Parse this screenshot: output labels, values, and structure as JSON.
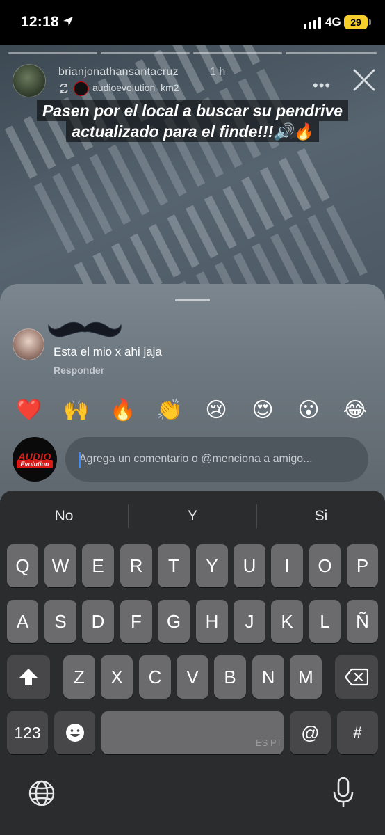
{
  "status_bar": {
    "time": "12:18",
    "network": "4G",
    "battery": "29"
  },
  "story": {
    "username": "brianjonathansantacruz",
    "time_ago": "1 h",
    "repost_from": "audioevolution_km2",
    "caption_line1": "Pasen por el local a buscar su pendrive",
    "caption_line2": "actualizado para el finde!!!🔊🔥"
  },
  "comments": {
    "text": "Esta el mio x ahi jaja",
    "reply_label": "Responder"
  },
  "reactions": [
    "❤️",
    "🙌",
    "🔥",
    "👏",
    "😢",
    "😍",
    "😮",
    "😂"
  ],
  "composer": {
    "placeholder": "Agrega un comentario o @menciona a amigo...",
    "avatar_text_top": "AUDIO",
    "avatar_text_bottom": "Evolution"
  },
  "keyboard": {
    "suggestions": [
      "No",
      "Y",
      "Si"
    ],
    "row1": [
      "Q",
      "W",
      "E",
      "R",
      "T",
      "Y",
      "U",
      "I",
      "O",
      "P"
    ],
    "row2": [
      "A",
      "S",
      "D",
      "F",
      "G",
      "H",
      "J",
      "K",
      "L",
      "Ñ"
    ],
    "row3": [
      "Z",
      "X",
      "C",
      "V",
      "B",
      "N",
      "M"
    ],
    "numbers_key": "123",
    "at_key": "@",
    "hash_key": "#",
    "space_lang": "ES PT"
  }
}
